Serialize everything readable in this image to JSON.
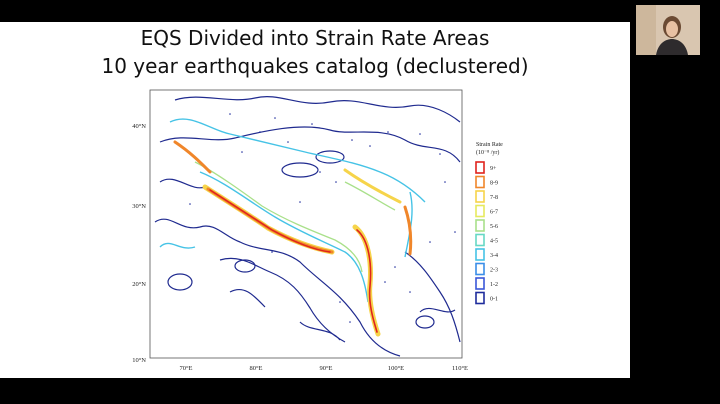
{
  "slide": {
    "title_line1": "EQS Divided into Strain Rate Areas",
    "title_line2": "10 year earthquakes catalog (declustered)"
  },
  "map": {
    "y_ticks": [
      "40°N",
      "30°N",
      "20°N",
      "10°N"
    ],
    "x_ticks": [
      "70°E",
      "80°E",
      "90°E",
      "100°E",
      "110°E"
    ],
    "legend": {
      "title_line1": "Strain Rate",
      "title_line2": "(10⁻⁸ /yr)",
      "items": [
        {
          "label": "9+",
          "color": "#e0231d"
        },
        {
          "label": "8-9",
          "color": "#f0862a"
        },
        {
          "label": "7-8",
          "color": "#f6d44a"
        },
        {
          "label": "6-7",
          "color": "#e6ea5e"
        },
        {
          "label": "5-6",
          "color": "#a9e08a"
        },
        {
          "label": "4-5",
          "color": "#66d8c4"
        },
        {
          "label": "3-4",
          "color": "#46c3e6"
        },
        {
          "label": "2-3",
          "color": "#3a8ee8"
        },
        {
          "label": "1-2",
          "color": "#3a56d8"
        },
        {
          "label": "0-1",
          "color": "#1e2c9c"
        }
      ]
    }
  },
  "toolbar": {
    "buttons": [
      {
        "name": "prev-slide-button",
        "icon": "◀"
      },
      {
        "name": "pen-tool-button",
        "icon": "✎"
      },
      {
        "name": "slides-grid-button",
        "icon": "▦"
      },
      {
        "name": "zoom-button",
        "icon": "⊕"
      },
      {
        "name": "next-slide-button",
        "icon": "▶"
      }
    ]
  },
  "video": {
    "participant": "presenter-webcam"
  }
}
